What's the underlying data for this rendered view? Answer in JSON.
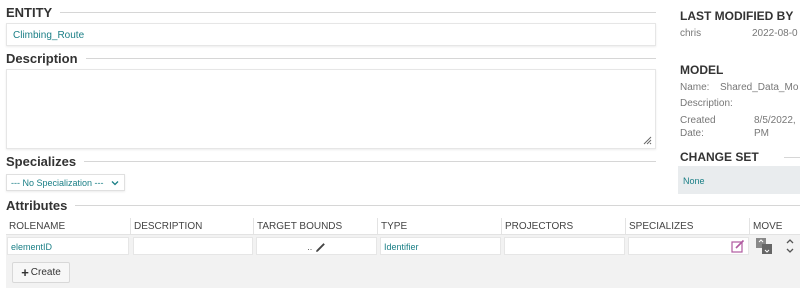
{
  "entity": {
    "heading": "ENTITY",
    "value": "Climbing_Route"
  },
  "description": {
    "heading": "Description",
    "value": ""
  },
  "specializes": {
    "heading": "Specializes",
    "selected": "--- No Specialization ---"
  },
  "attributes": {
    "heading": "Attributes",
    "columns": [
      "ROLENAME",
      "DESCRIPTION",
      "TARGET BOUNDS",
      "TYPE",
      "PROJECTORS",
      "SPECIALIZES",
      "MOVE"
    ],
    "rows": [
      {
        "rolename": "elementID",
        "description": "",
        "target_bounds": "..",
        "type": "Identifier",
        "projectors": "",
        "specializes": ""
      }
    ],
    "create_label": "Create"
  },
  "last_modified": {
    "heading": "LAST MODIFIED BY",
    "user": "chris",
    "date": "2022-08-0"
  },
  "model": {
    "heading": "MODEL",
    "name_label": "Name:",
    "name_value": "Shared_Data_Mo",
    "description_label": "Description:",
    "created_label_1": "Created",
    "created_label_2": "Date:",
    "created_value_1": "8/5/2022,",
    "created_value_2": "PM"
  },
  "change_set": {
    "heading": "CHANGE SET",
    "value": "None"
  },
  "colors": {
    "accent": "#1a7f86",
    "edit_icon": "#b05aa0",
    "move_icon": "#777777"
  }
}
